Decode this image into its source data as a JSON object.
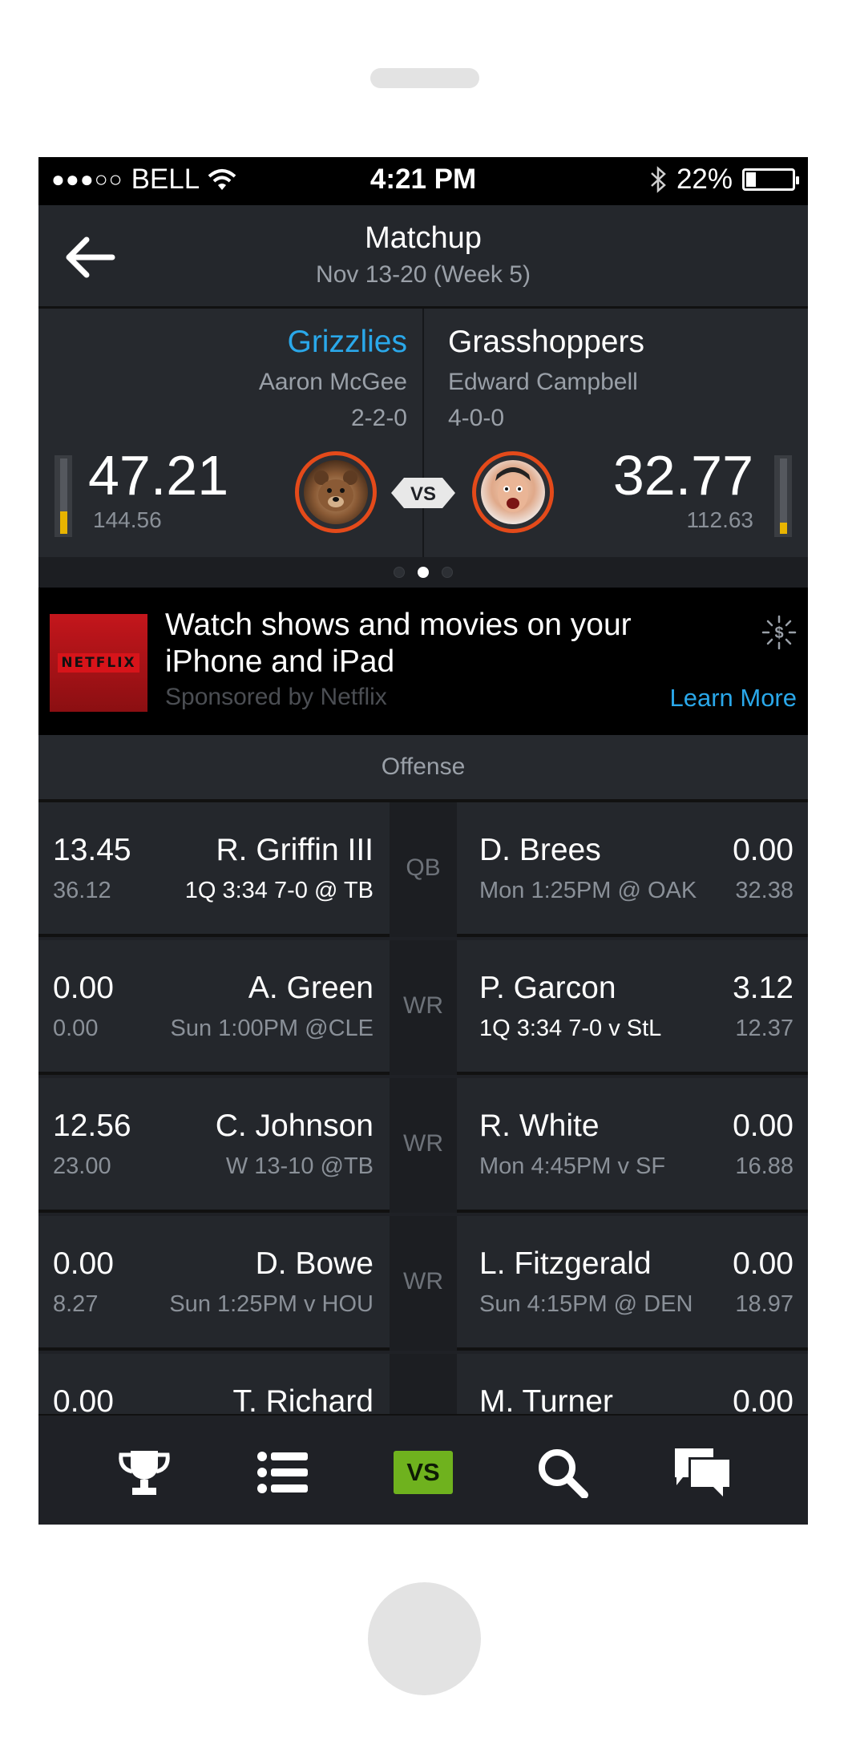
{
  "status_bar": {
    "signal": "●●●○○",
    "carrier": "BELL",
    "time": "4:21 PM",
    "battery_text": "22%",
    "battery_level": 0.22
  },
  "nav": {
    "title": "Matchup",
    "subtitle": "Nov 13-20 (Week 5)"
  },
  "matchup": {
    "left": {
      "team": "Grizzlies",
      "owner": "Aaron McGee",
      "record": "2-2-0",
      "score": "47.21",
      "projected": "144.56",
      "progress": 0.3
    },
    "right": {
      "team": "Grasshoppers",
      "owner": "Edward Campbell",
      "record": "4-0-0",
      "score": "32.77",
      "projected": "112.63",
      "progress": 0.15
    },
    "vs_label": "VS",
    "page_index": 2,
    "page_count": 3
  },
  "ad": {
    "logo_text": "NETFLIX",
    "title": "Watch shows and movies on your iPhone and iPad",
    "sponsor": "Sponsored by Netflix",
    "cta": "Learn More"
  },
  "section_title": "Offense",
  "roster": [
    {
      "position": "QB",
      "left": {
        "points": "13.45",
        "projected": "36.12",
        "name": "R. Griffin III",
        "info": "1Q 3:34 7-0 @ TB",
        "live": true
      },
      "right": {
        "points": "0.00",
        "projected": "32.38",
        "name": "D. Brees",
        "info": "Mon 1:25PM @ OAK",
        "live": false
      }
    },
    {
      "position": "WR",
      "left": {
        "points": "0.00",
        "projected": "0.00",
        "name": "A. Green",
        "info": "Sun 1:00PM @CLE",
        "live": false
      },
      "right": {
        "points": "3.12",
        "projected": "12.37",
        "name": "P. Garcon",
        "info": "1Q 3:34 7-0 v StL",
        "live": true
      }
    },
    {
      "position": "WR",
      "left": {
        "points": "12.56",
        "projected": "23.00",
        "name": "C. Johnson",
        "info": "W 13-10 @TB",
        "live": false
      },
      "right": {
        "points": "0.00",
        "projected": "16.88",
        "name": "R. White",
        "info": "Mon 4:45PM v SF",
        "live": false
      }
    },
    {
      "position": "WR",
      "left": {
        "points": "0.00",
        "projected": "8.27",
        "name": "D. Bowe",
        "info": "Sun 1:25PM v HOU",
        "live": false
      },
      "right": {
        "points": "0.00",
        "projected": "18.97",
        "name": "L. Fitzgerald",
        "info": "Sun 4:15PM @ DEN",
        "live": false
      }
    },
    {
      "position": "",
      "left": {
        "points": "0.00",
        "projected": "",
        "name": "T. Richard",
        "info": "",
        "live": false
      },
      "right": {
        "points": "0.00",
        "projected": "",
        "name": "M. Turner",
        "info": "",
        "live": false
      }
    }
  ],
  "tabbar": {
    "items": [
      {
        "icon": "trophy-icon"
      },
      {
        "icon": "list-icon"
      },
      {
        "icon": "vs-icon",
        "label": "VS",
        "active": true
      },
      {
        "icon": "search-icon"
      },
      {
        "icon": "chat-icon"
      }
    ]
  },
  "colors": {
    "accent_blue": "#2aa8ea",
    "accent_green": "#6fb21e",
    "avatar_ring": "#e44a1a",
    "meter_yellow": "#e8b400"
  }
}
